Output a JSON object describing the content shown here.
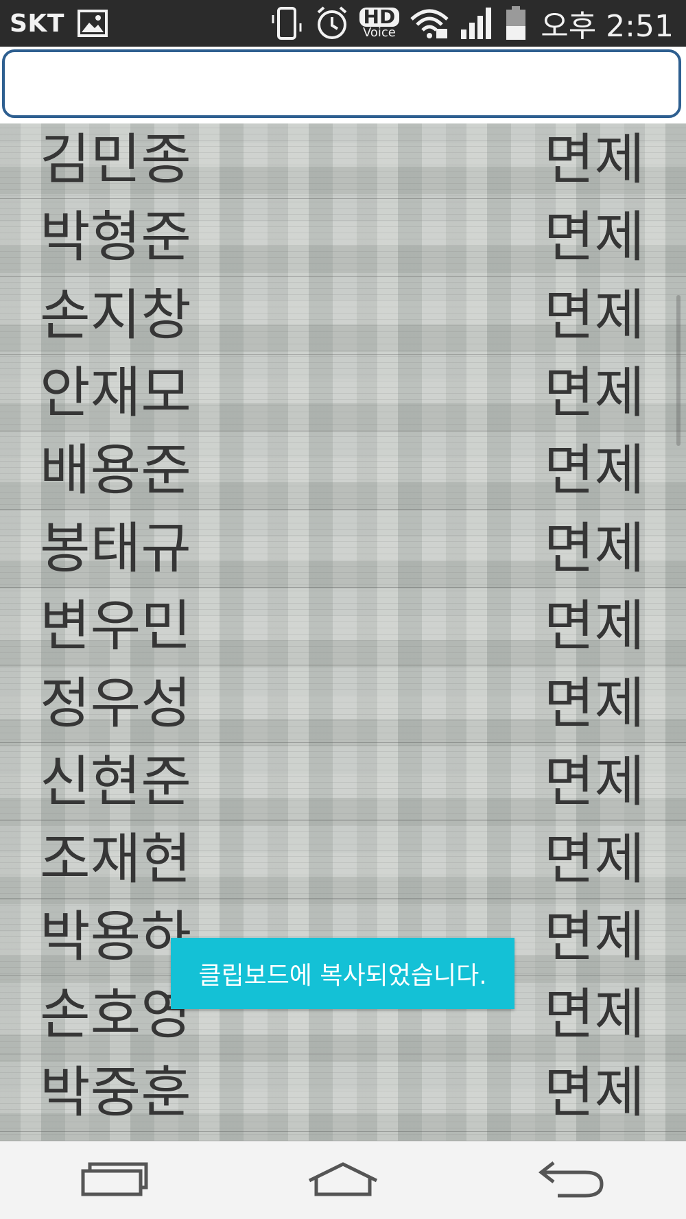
{
  "status_bar": {
    "carrier": "SKT",
    "hd_label": "HD",
    "voice_label": "Voice",
    "time": "오후 2:51",
    "icons": [
      "gallery-icon",
      "vibrate-icon",
      "alarm-icon",
      "hd-voice-icon",
      "wifi-icon",
      "signal-icon",
      "battery-icon"
    ]
  },
  "input": {
    "value": "",
    "placeholder": ""
  },
  "list": {
    "rows": [
      {
        "name": "김민종",
        "status": "면제"
      },
      {
        "name": "박형준",
        "status": "면제"
      },
      {
        "name": "손지창",
        "status": "면제"
      },
      {
        "name": "안재모",
        "status": "면제"
      },
      {
        "name": "배용준",
        "status": "면제"
      },
      {
        "name": "봉태규",
        "status": "면제"
      },
      {
        "name": "변우민",
        "status": "면제"
      },
      {
        "name": "정우성",
        "status": "면제"
      },
      {
        "name": "신현준",
        "status": "면제"
      },
      {
        "name": "조재현",
        "status": "면제"
      },
      {
        "name": "박용하",
        "status": "면제"
      },
      {
        "name": "손호영",
        "status": "면제"
      },
      {
        "name": "박중훈",
        "status": "면제"
      }
    ]
  },
  "toast": {
    "message": "클립보드에 복사되었습니다."
  },
  "nav_bar": {
    "buttons": [
      "recent-apps-icon",
      "home-icon",
      "back-icon"
    ]
  },
  "colors": {
    "status_bar_bg": "#2b2b2b",
    "input_border": "#2e5f90",
    "toast_bg": "#14c1d6",
    "text": "#363636",
    "nav_bg": "#f3f3f3"
  }
}
